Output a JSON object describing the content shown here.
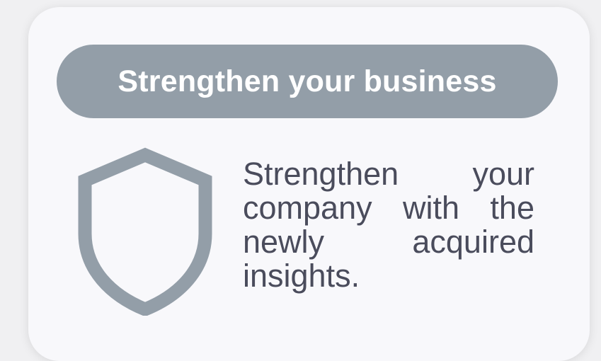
{
  "card": {
    "title": "Strengthen your business",
    "description": "Strengthen your company with the newly acquired insights.",
    "icon": "shield-icon"
  },
  "colors": {
    "pill_background": "#939ea8",
    "pill_text": "#ffffff",
    "card_background": "#f8f8fb",
    "description_text": "#4a4c5c",
    "icon": "#939ea8"
  }
}
